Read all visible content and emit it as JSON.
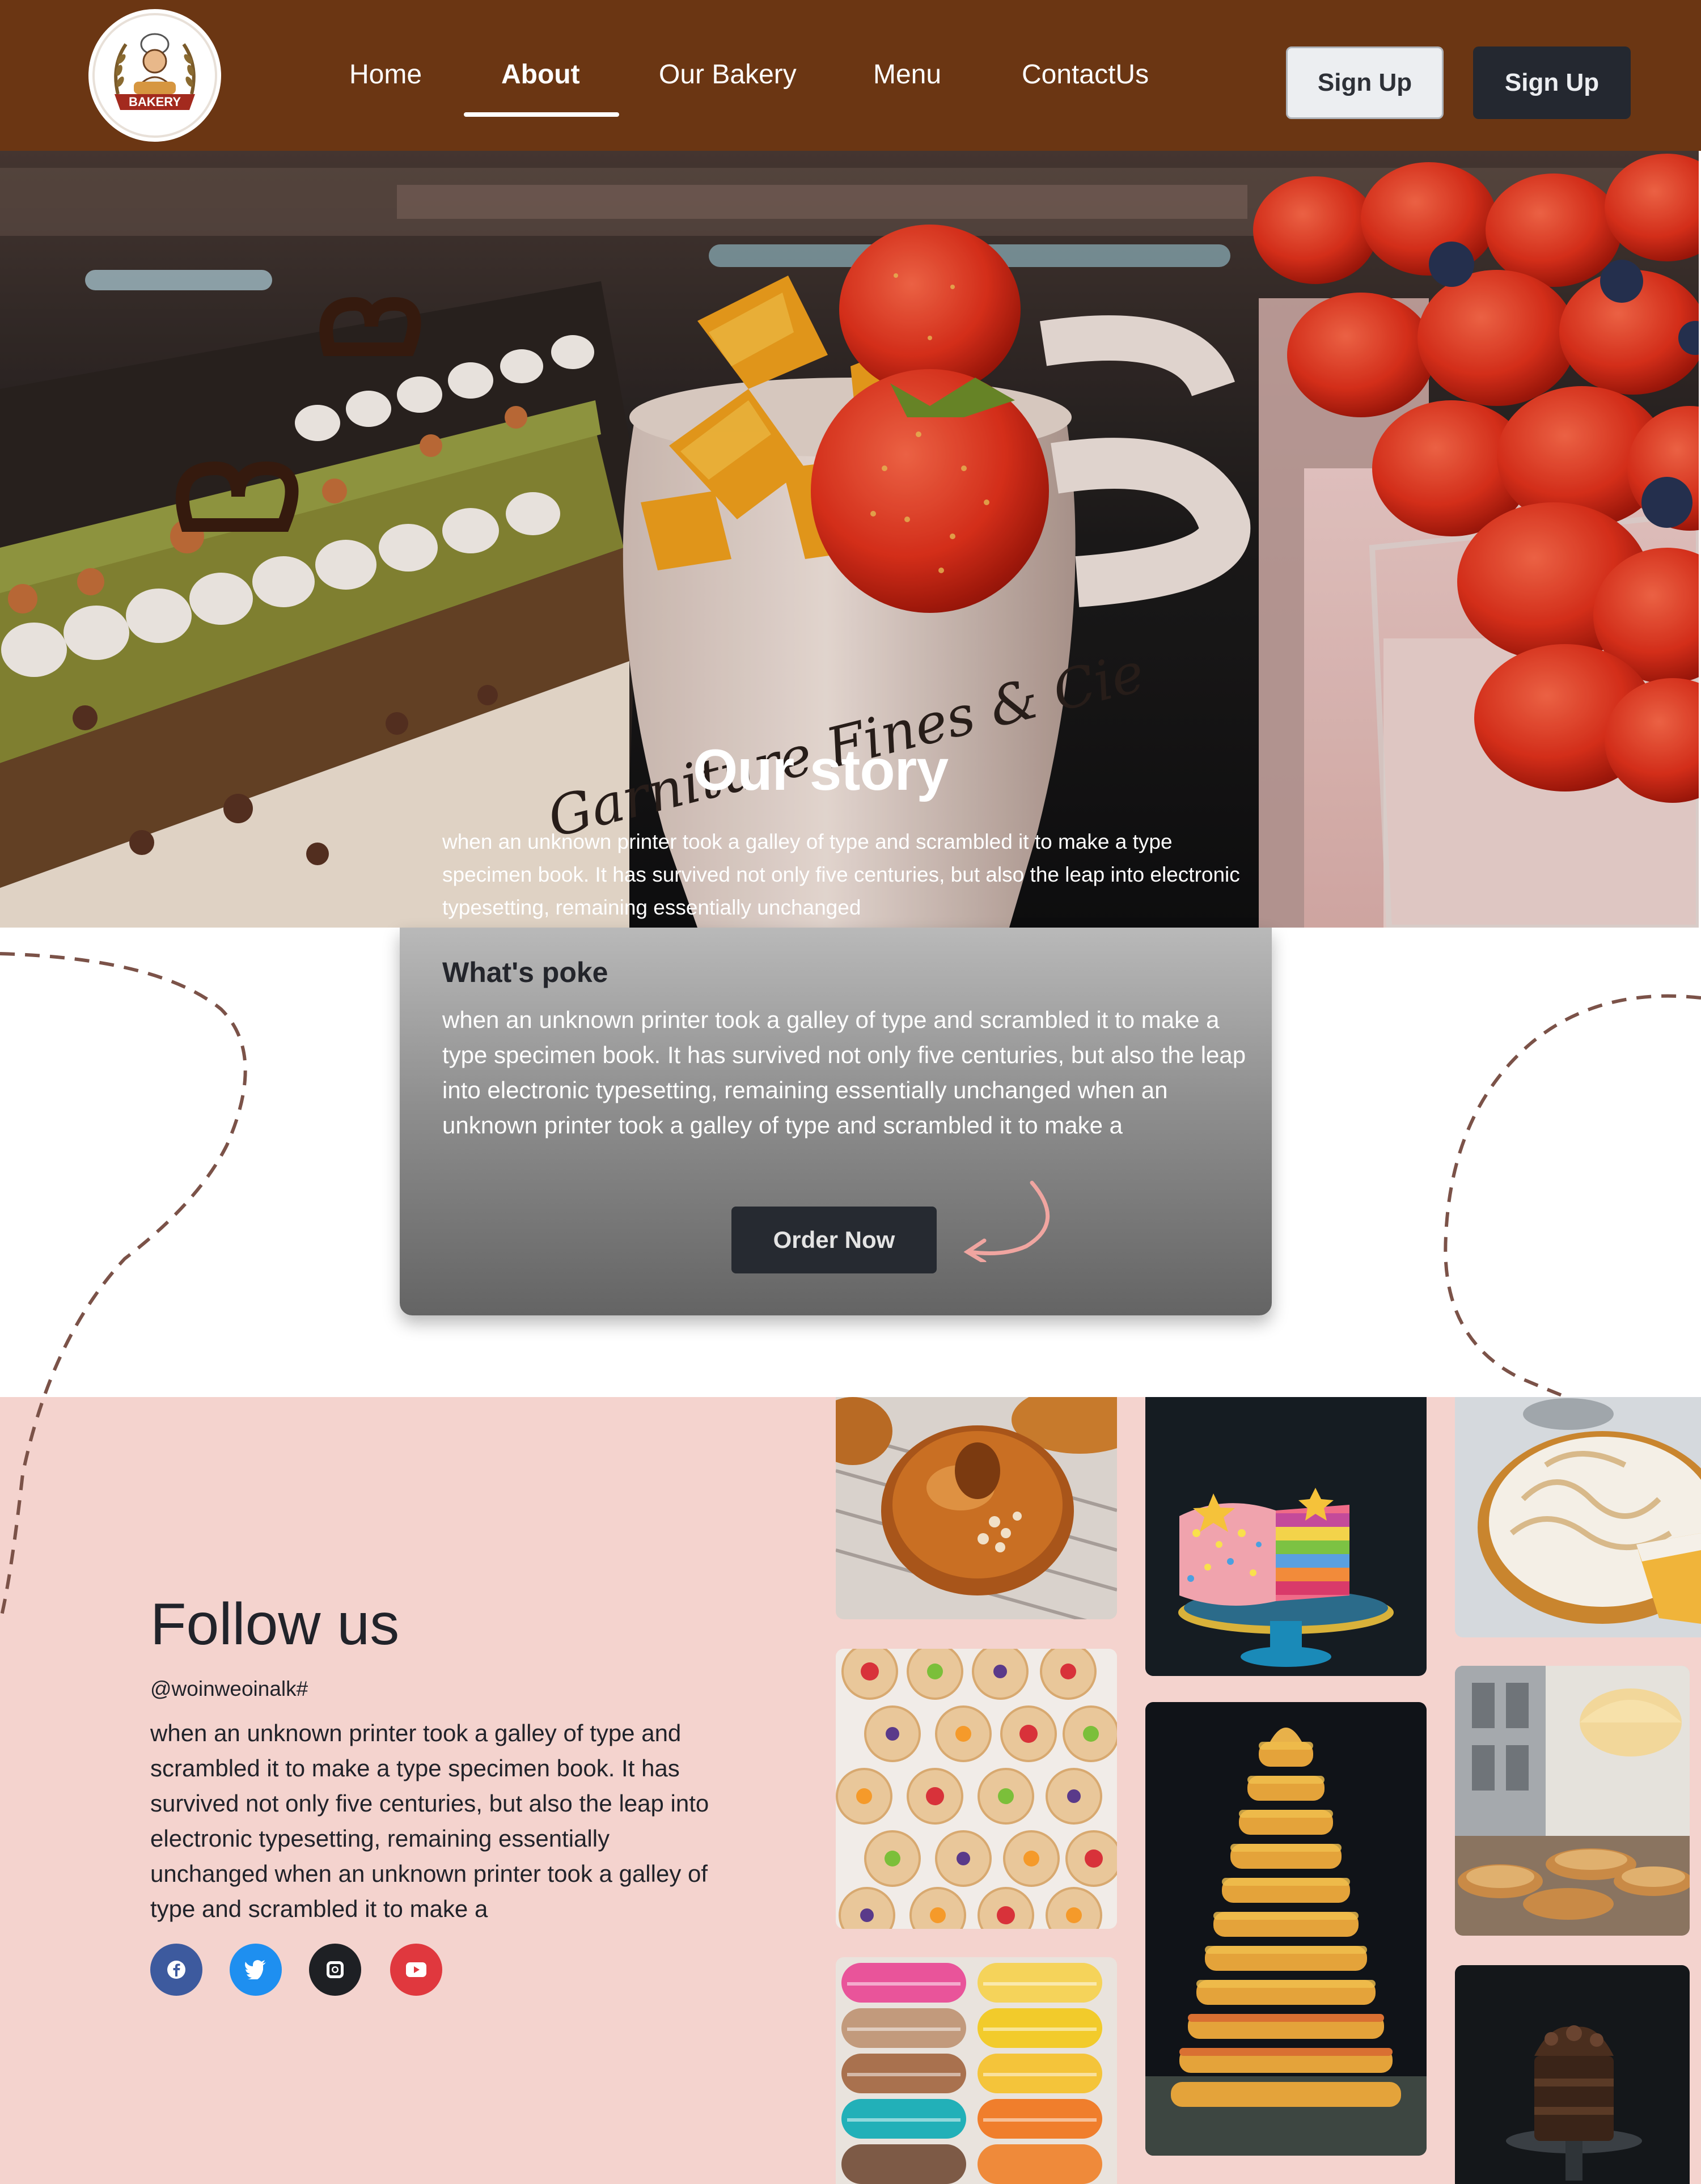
{
  "nav": {
    "logo_text": "BAKERY",
    "links": [
      "Home",
      "About",
      "Our Bakery",
      "Menu",
      "ContactUs"
    ],
    "active": "About",
    "signup_light": "Sign Up",
    "signup_dark": "Sign Up"
  },
  "hero": {
    "title": "Our story",
    "text": "when an unknown printer took a galley of type and scrambled it to make a type specimen book. It has survived not only five centuries, but also the leap into electronic typesetting, remaining essentially unchanged",
    "pot_text": "Garniture Fines & Cie"
  },
  "card": {
    "title": "What's poke",
    "text": "when an unknown printer took a galley of type and scrambled it to make a type specimen book. It has survived not only five centuries, but also the leap into electronic typesetting, remaining essentially unchanged when an unknown printer took a galley of type and scrambled it to make a",
    "button": "Order Now"
  },
  "follow": {
    "title": "Follow us",
    "handle": "@woinweoinalk#",
    "text": "when an unknown printer took a galley of type and scrambled it to make a type specimen book. It has survived not only five centuries, but also the leap into electronic typesetting, remaining essentially unchanged when an unknown printer took a galley of type and scrambled it to make a",
    "socials": [
      {
        "name": "facebook-icon",
        "color": "#3d5a9e"
      },
      {
        "name": "twitter-icon",
        "color": "#1e8ff0"
      },
      {
        "name": "instagram-icon",
        "color": "#1e2024"
      },
      {
        "name": "youtube-icon",
        "color": "#e0383e"
      }
    ]
  },
  "colors": {
    "nav_bg": "#6b3613",
    "follow_bg": "#f4d3ce",
    "dark_button": "#242830",
    "dashed_line": "#7b5248"
  }
}
